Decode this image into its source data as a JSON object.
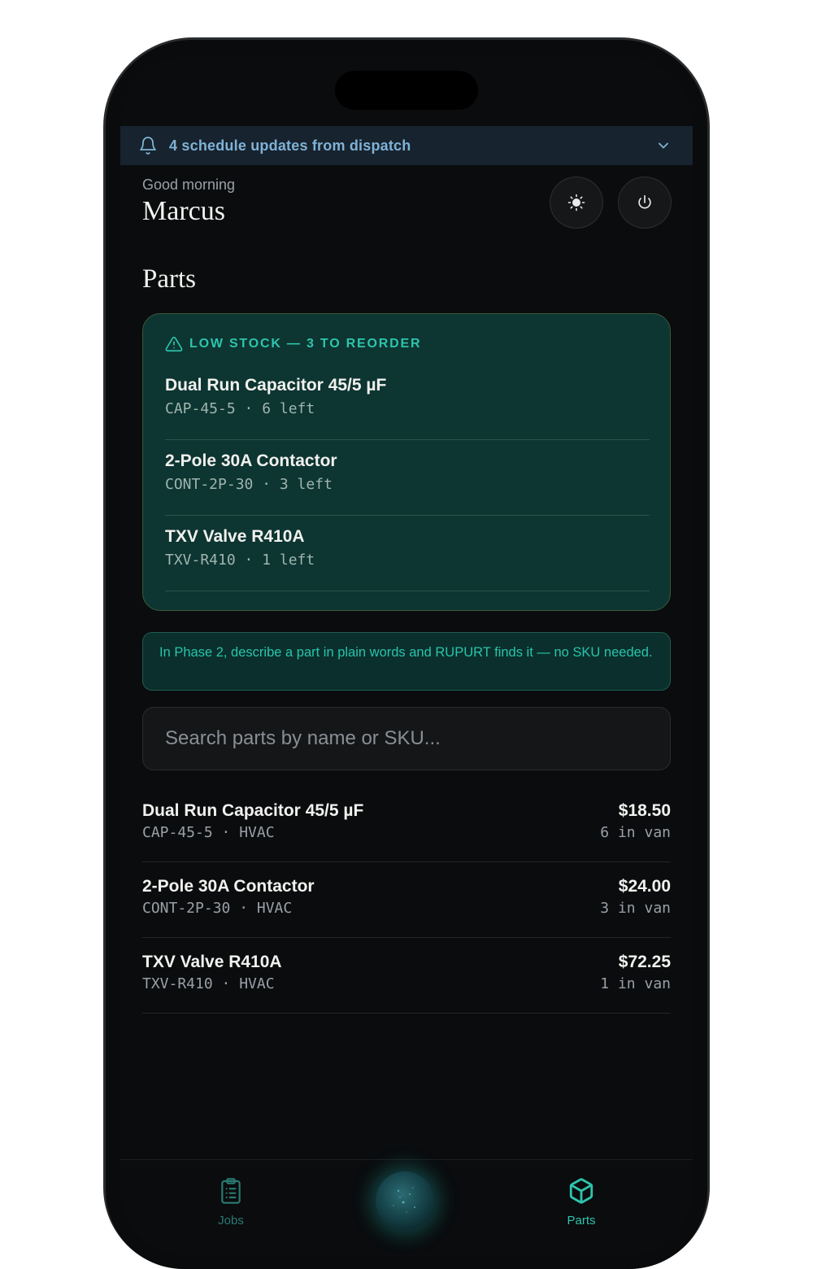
{
  "banner": {
    "text": "4 schedule updates from dispatch",
    "icon": "bell-icon",
    "expand_icon": "chevron-down-icon"
  },
  "greeting": {
    "salutation": "Good morning",
    "name": "Marcus"
  },
  "header_actions": {
    "theme_icon": "sun-icon",
    "power_icon": "power-icon"
  },
  "section_title": "Parts",
  "low_stock": {
    "label": "LOW STOCK — 3 TO REORDER",
    "icon": "warning-icon",
    "items": [
      {
        "name": "Dual Run Capacitor 45/5 µF",
        "meta": "CAP-45-5 · 6 left"
      },
      {
        "name": "2-Pole 30A Contactor",
        "meta": "CONT-2P-30 · 3 left"
      },
      {
        "name": "TXV Valve R410A",
        "meta": "TXV-R410 · 1 left"
      }
    ]
  },
  "tip": "In Phase 2, describe a part in plain words and RUPURT finds it — no SKU needed.",
  "search": {
    "placeholder": "Search parts by name or SKU..."
  },
  "parts": [
    {
      "name": "Dual Run Capacitor 45/5 µF",
      "meta": "CAP-45-5 · HVAC",
      "price": "$18.50",
      "qty": "6 in van"
    },
    {
      "name": "2-Pole 30A Contactor",
      "meta": "CONT-2P-30 · HVAC",
      "price": "$24.00",
      "qty": "3 in van"
    },
    {
      "name": "TXV Valve R410A",
      "meta": "TXV-R410 · HVAC",
      "price": "$72.25",
      "qty": "1 in van"
    }
  ],
  "nav": {
    "jobs": {
      "label": "Jobs",
      "icon": "clipboard-icon"
    },
    "assistant": {
      "icon": "assistant-orb-icon"
    },
    "parts": {
      "label": "Parts",
      "icon": "box-icon"
    }
  },
  "colors": {
    "accent": "#2ec4ad",
    "banner_text": "#7fb2d6",
    "card_bg": "#0d3531",
    "background": "#0a0c0e"
  }
}
